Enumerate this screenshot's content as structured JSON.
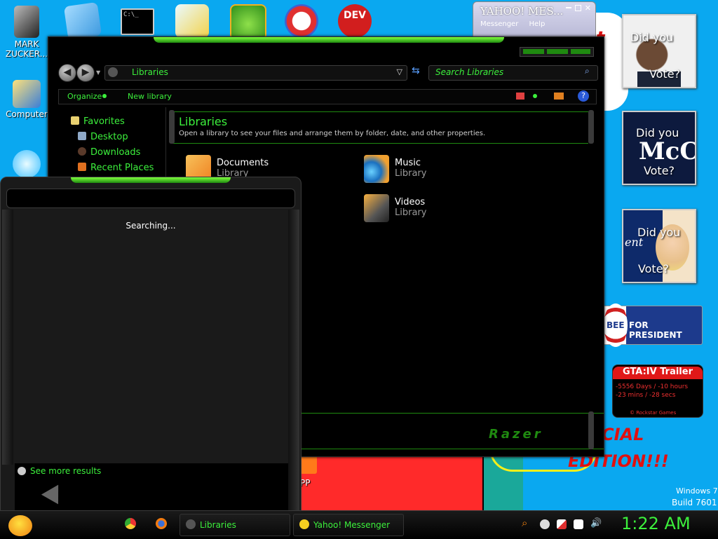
{
  "desktop": {
    "icons": [
      {
        "label": "MARK ZUCKER..."
      },
      {
        "label": "Computer"
      }
    ],
    "partial_label": "PP",
    "os_watermark": {
      "line1": "Windows 7",
      "line2": "Build 7601"
    }
  },
  "yahoo_window": {
    "title": "YAHOO! MES...",
    "menu": [
      "Messenger",
      "Help"
    ]
  },
  "gadgets": {
    "vote1": {
      "line1": "Did you",
      "line2": "Vote?"
    },
    "vote2": {
      "line1": "Did you",
      "line2": "Vote?",
      "overlay": "McC"
    },
    "vote3": {
      "line1": "Did you",
      "line2": "Vote?",
      "overlay": "ent"
    },
    "huckabee": {
      "part": "BEE",
      "text": "FOR PRESIDENT"
    },
    "gta": {
      "title": "GTA:IV Trailer",
      "line1": "-5556 Days / -10 hours",
      "line2": "-23 mins / -28 secs",
      "footer": "© Rockstar Games"
    },
    "wallpaper_text": {
      "line1": "CIAL",
      "line2": "EDITION!!!"
    }
  },
  "explorer": {
    "address": "Libraries",
    "search_placeholder": "Search Libraries",
    "toolbar": {
      "organize": "Organize",
      "new_library": "New library"
    },
    "nav": {
      "favorites": "Favorites",
      "items": [
        "Desktop",
        "Downloads",
        "Recent Places"
      ]
    },
    "header": {
      "title": "Libraries",
      "subtitle": "Open a library to see your files and arrange them by folder, date, and other properties."
    },
    "libraries": [
      {
        "name": "Documents",
        "type": "Library"
      },
      {
        "name": "Music",
        "type": "Library"
      },
      {
        "name": "Videos",
        "type": "Library"
      }
    ],
    "brand": "Razer"
  },
  "search_panel": {
    "status": "Searching...",
    "see_more": "See more results"
  },
  "taskbar": {
    "buttons": [
      {
        "label": "Libraries"
      },
      {
        "label": "Yahoo! Messenger"
      }
    ],
    "clock": "1:22 AM"
  }
}
